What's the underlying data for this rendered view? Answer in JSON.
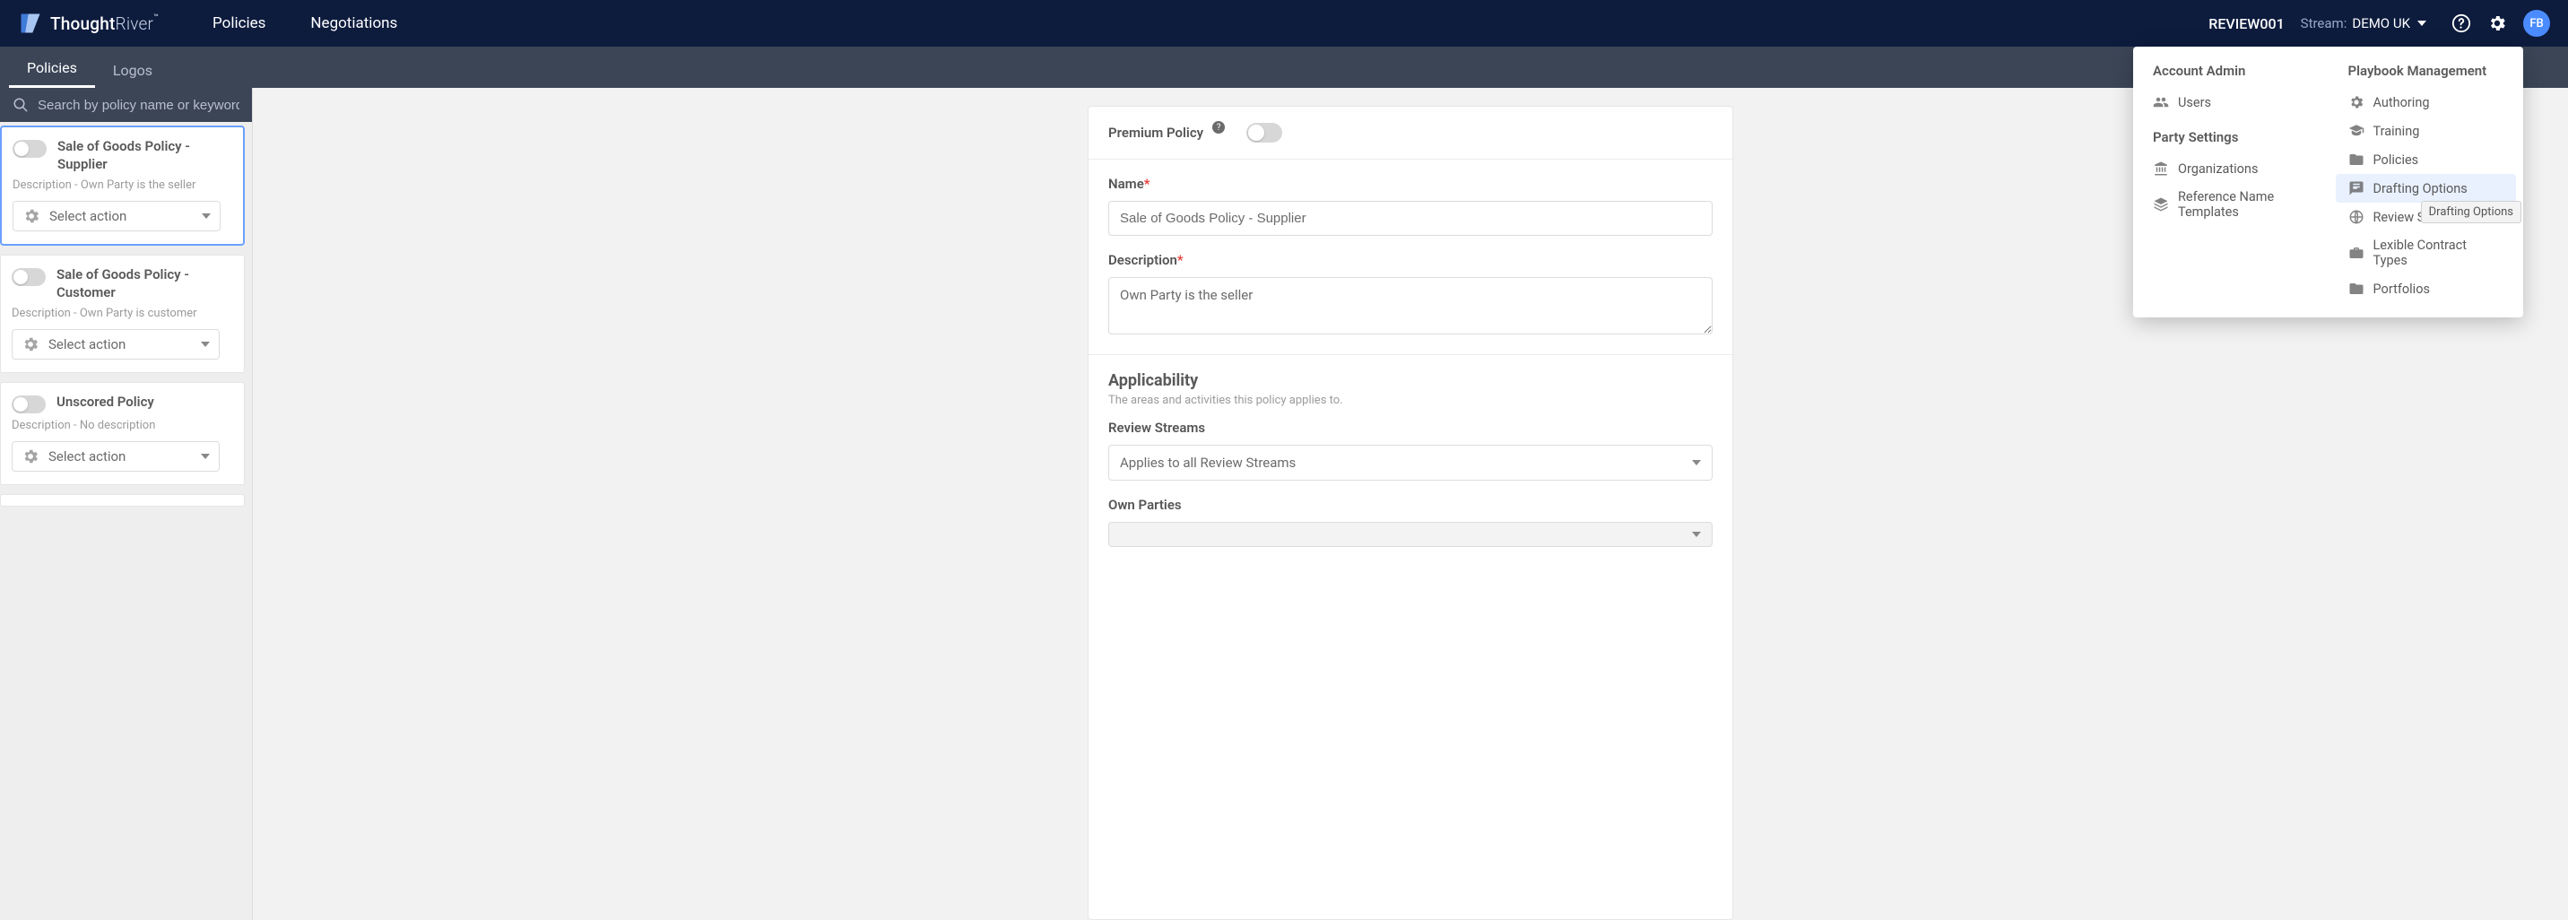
{
  "brand": {
    "name_strong": "Thought",
    "name_light": "River",
    "tm": "™"
  },
  "topnav": {
    "policies": "Policies",
    "negotiations": "Negotiations"
  },
  "header": {
    "review_id": "REVIEW001",
    "stream_label": "Stream:",
    "stream_value": "DEMO UK",
    "avatar_initials": "FB"
  },
  "subtabs": {
    "policies": "Policies",
    "logos": "Logos"
  },
  "search": {
    "placeholder": "Search by policy name or keyword"
  },
  "policy_list": {
    "action_label": "Select action",
    "items": [
      {
        "title": "Sale of Goods Policy - Supplier",
        "desc": "Description - Own Party is the seller"
      },
      {
        "title": "Sale of Goods Policy - Customer",
        "desc": "Description - Own Party is customer"
      },
      {
        "title": "Unscored Policy",
        "desc": "Description - No description"
      }
    ]
  },
  "form": {
    "premium_label": "Premium Policy",
    "name_label": "Name",
    "name_value": "Sale of Goods Policy - Supplier",
    "description_label": "Description",
    "description_value": "Own Party is the seller",
    "applicability_title": "Applicability",
    "applicability_sub": "The areas and activities this policy applies to.",
    "review_streams_label": "Review Streams",
    "review_streams_value": "Applies to all Review Streams",
    "own_parties_label": "Own Parties"
  },
  "settings_panel": {
    "col1_heading": "Account Admin",
    "col1_section2": "Party Settings",
    "users": "Users",
    "organizations": "Organizations",
    "ref_name_templates": "Reference Name Templates",
    "col2_heading": "Playbook Management",
    "authoring": "Authoring",
    "training": "Training",
    "policies": "Policies",
    "drafting_options": "Drafting Options",
    "review_streams": "Review Streams",
    "lexible_contract_types": "Lexible Contract Types",
    "portfolios": "Portfolios",
    "tooltip": "Drafting Options"
  }
}
